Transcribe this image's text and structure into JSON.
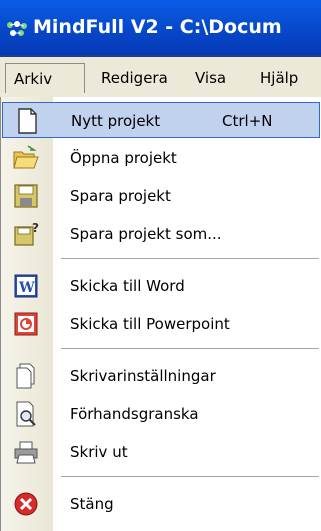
{
  "window": {
    "title": "MindFull V2 - C:\\Docum"
  },
  "menubar": {
    "items": [
      {
        "label": "Arkiv"
      },
      {
        "label": "Redigera"
      },
      {
        "label": "Visa"
      },
      {
        "label": "Hjälp"
      }
    ]
  },
  "menu": {
    "items": [
      {
        "label": "Nytt projekt",
        "shortcut": "Ctrl+N",
        "icon": "new-document-icon"
      },
      {
        "label": "Öppna projekt",
        "icon": "open-folder-icon"
      },
      {
        "label": "Spara projekt",
        "icon": "save-floppy-icon"
      },
      {
        "label": "Spara projekt som...",
        "icon": "save-as-icon"
      },
      {
        "label": "Skicka till Word",
        "icon": "word-icon"
      },
      {
        "label": "Skicka till Powerpoint",
        "icon": "powerpoint-icon"
      },
      {
        "label": "Skrivarinställningar",
        "icon": "page-setup-icon"
      },
      {
        "label": "Förhandsgranska",
        "icon": "print-preview-icon"
      },
      {
        "label": "Skriv ut",
        "icon": "printer-icon"
      },
      {
        "label": "Stäng",
        "icon": "close-circle-icon"
      }
    ],
    "word_badge": "W"
  },
  "colors": {
    "title_bar": "#0a5de6",
    "menu_highlight": "#c1d2ee",
    "highlight_border": "#316ac5",
    "word_blue": "#2b4fae",
    "powerpoint_red": "#e04236",
    "close_red": "#d42b2b"
  }
}
